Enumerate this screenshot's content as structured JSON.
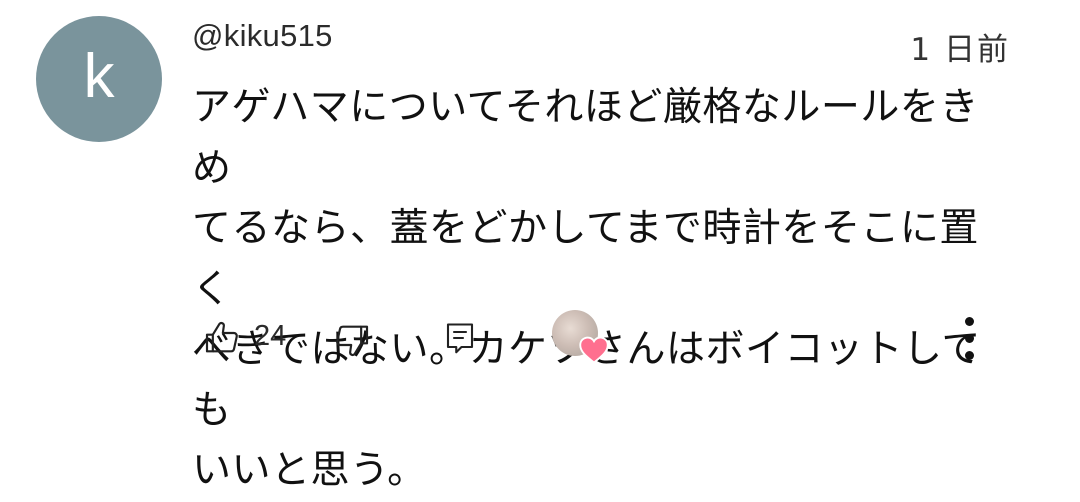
{
  "comment": {
    "avatar_letter": "k",
    "avatar_color": "#7a949c",
    "author_handle": "@kiku515",
    "timestamp": "1 日前",
    "text": "アゲハマについてそれほど厳格なルールをきめ\nてるなら、蓋をどかしてまで時計をそこに置く\nべきではない。カケツさんはボイコットしても\nいいと思う。",
    "like_count": "24",
    "heart_color": "#ff6f8f"
  },
  "icons": {
    "like": "thumbs-up-icon",
    "dislike": "thumbs-down-icon",
    "reply": "reply-comment-icon",
    "creator_heart": "creator-heart-icon",
    "more": "more-vertical-icon"
  }
}
